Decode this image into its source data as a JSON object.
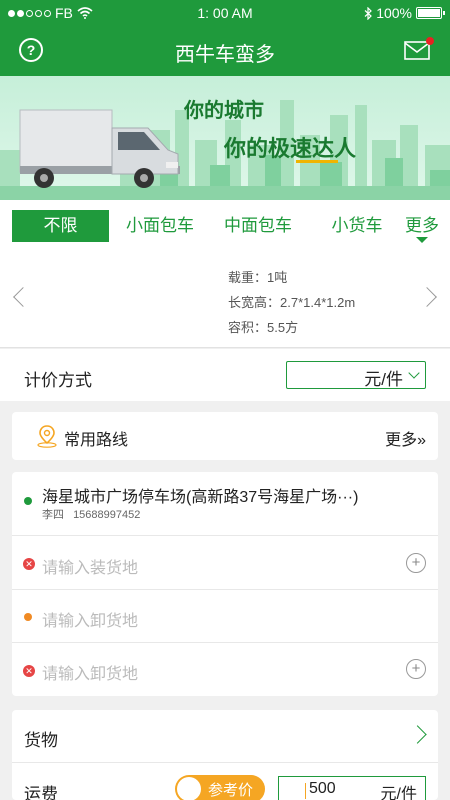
{
  "status_bar": {
    "carrier": "FB",
    "time": "1: 00  AM",
    "battery": "100%"
  },
  "nav": {
    "title": "西牛车蛮多",
    "help_glyph": "?",
    "help_icon": "question-circle-icon",
    "mail_icon": "mail-icon"
  },
  "banner": {
    "line1": "你的城市",
    "line2": "你的极速达人"
  },
  "tabs": [
    {
      "label": "不限",
      "active": true
    },
    {
      "label": "小面包车",
      "active": false
    },
    {
      "label": "中面包车",
      "active": false
    },
    {
      "label": "小货车",
      "active": false
    },
    {
      "label": "更多",
      "active": false
    }
  ],
  "vehicle": {
    "load": "载重：1吨",
    "dimensions": "长宽高：2.7*1.4*1.2m",
    "volume": "容积：5.5方"
  },
  "pricing": {
    "label": "计价方式",
    "selected": "元/件"
  },
  "routes": {
    "label": "常用路线",
    "more": "更多»"
  },
  "addresses": {
    "origin": {
      "address": "海星城市广场停车场(高新路37号海星广场···)",
      "contact": "李四",
      "phone": "15688997452"
    },
    "loading_placeholder": "请输入装货地",
    "unloading_placeholder_1": "请输入卸货地",
    "unloading_placeholder_2": "请输入卸货地",
    "remove_glyph": "✕",
    "add_glyph": "+"
  },
  "cargo": {
    "label": "货物",
    "fee_label": "运费",
    "toggle_label": "参考价",
    "fee_value": "500",
    "fee_unit": "元/件"
  },
  "colors": {
    "brand_green": "#1f9a3c",
    "accent_orange": "#f5a623",
    "error_red": "#e64545"
  }
}
